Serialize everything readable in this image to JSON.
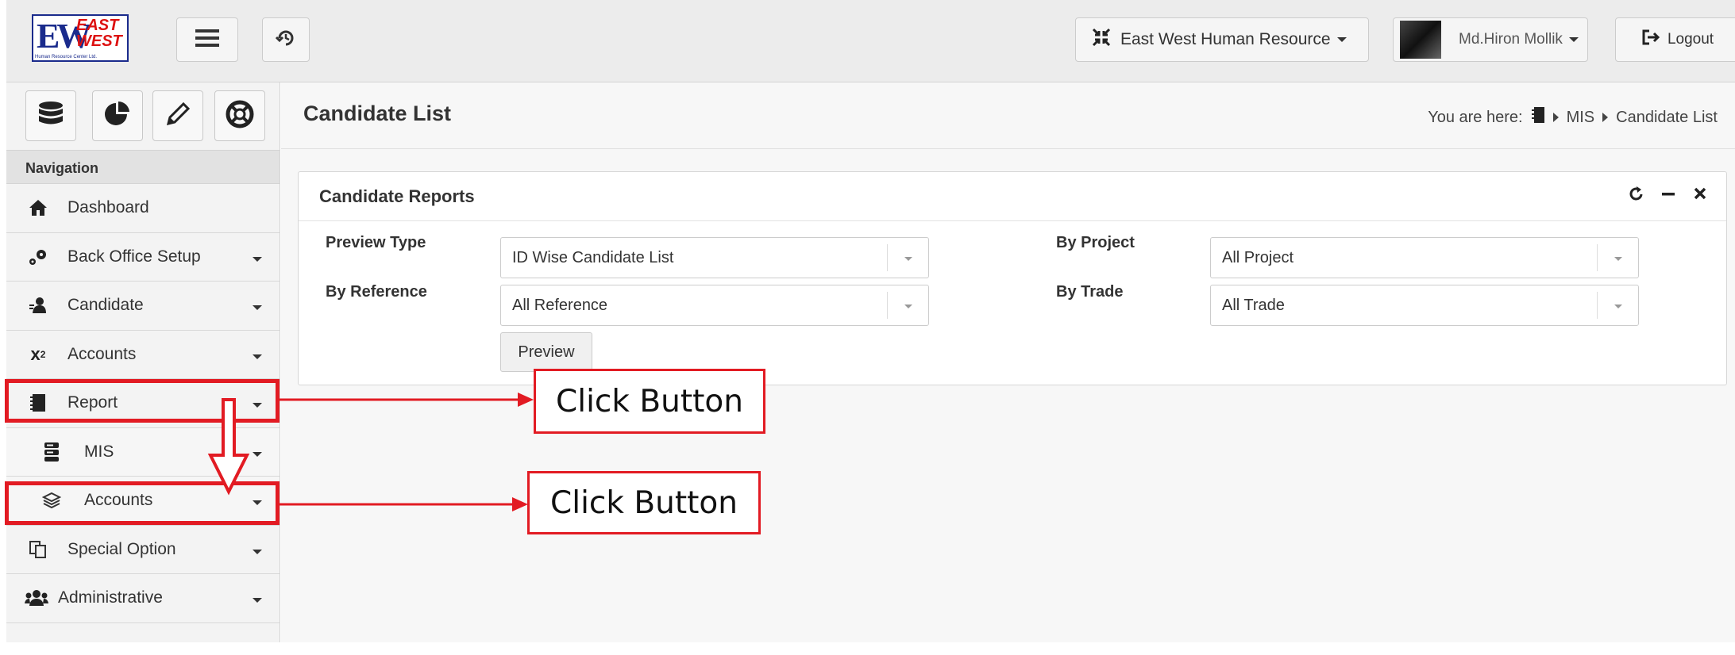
{
  "header": {
    "logo": {
      "main": "EW",
      "line1": "EAST",
      "line2": "WEST",
      "tagline": "Human Resource Center Ltd."
    },
    "company_selector": "East West Human Resource",
    "user_name": "Md.Hiron Mollik",
    "logout_label": "Logout"
  },
  "sidebar": {
    "nav_heading": "Navigation",
    "items": [
      {
        "label": "Dashboard",
        "icon": "home-icon"
      },
      {
        "label": "Back Office Setup",
        "icon": "cogs-icon"
      },
      {
        "label": "Candidate",
        "icon": "user-icon"
      },
      {
        "label": "Accounts",
        "icon": "superscript-icon"
      },
      {
        "label": "Report",
        "icon": "book-icon"
      },
      {
        "label": "MIS",
        "icon": "server-icon"
      },
      {
        "label": "Accounts",
        "icon": "layers-icon"
      },
      {
        "label": "Special Option",
        "icon": "copy-icon"
      },
      {
        "label": "Administrative",
        "icon": "users-icon"
      }
    ]
  },
  "main": {
    "page_title": "Candidate List",
    "breadcrumb": {
      "prefix": "You are here:",
      "items": [
        "MIS",
        "Candidate List"
      ]
    },
    "panel": {
      "title": "Candidate Reports",
      "tools": [
        "refresh-icon",
        "minimize-icon",
        "close-icon"
      ],
      "fields": {
        "preview_type": {
          "label": "Preview Type",
          "value": "ID Wise Candidate List"
        },
        "by_project": {
          "label": "By Project",
          "value": "All Project"
        },
        "by_reference": {
          "label": "By Reference",
          "value": "All Reference"
        },
        "by_trade": {
          "label": "By Trade",
          "value": "All Trade"
        }
      },
      "preview_button": "Preview"
    }
  },
  "annotations": {
    "callout1": "Click Button",
    "callout2": "Click Button",
    "color": "#e21b23"
  }
}
